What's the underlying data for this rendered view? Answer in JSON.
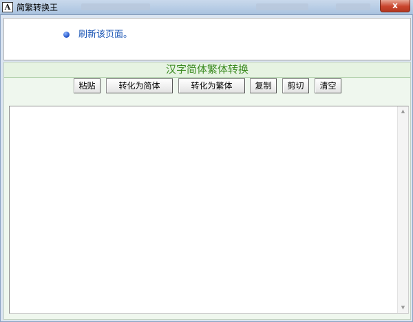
{
  "window": {
    "title": "简繁转换王",
    "app_icon_glyph": "A",
    "close_glyph": "x"
  },
  "message": {
    "refresh_text": "刷新该页面。"
  },
  "converter": {
    "heading": "汉字简体繁体转换",
    "buttons": {
      "paste": "粘贴",
      "to_simplified": "转化为简体",
      "to_traditional": "转化为繁体",
      "copy": "复制",
      "cut": "剪切",
      "clear": "清空"
    },
    "text_content": ""
  },
  "scrollbar": {
    "up_glyph": "▲",
    "down_glyph": "▼"
  },
  "colors": {
    "heading_green": "#3a8a1f",
    "link_blue": "#1a55b5",
    "panel_bg": "#eff7ee"
  }
}
